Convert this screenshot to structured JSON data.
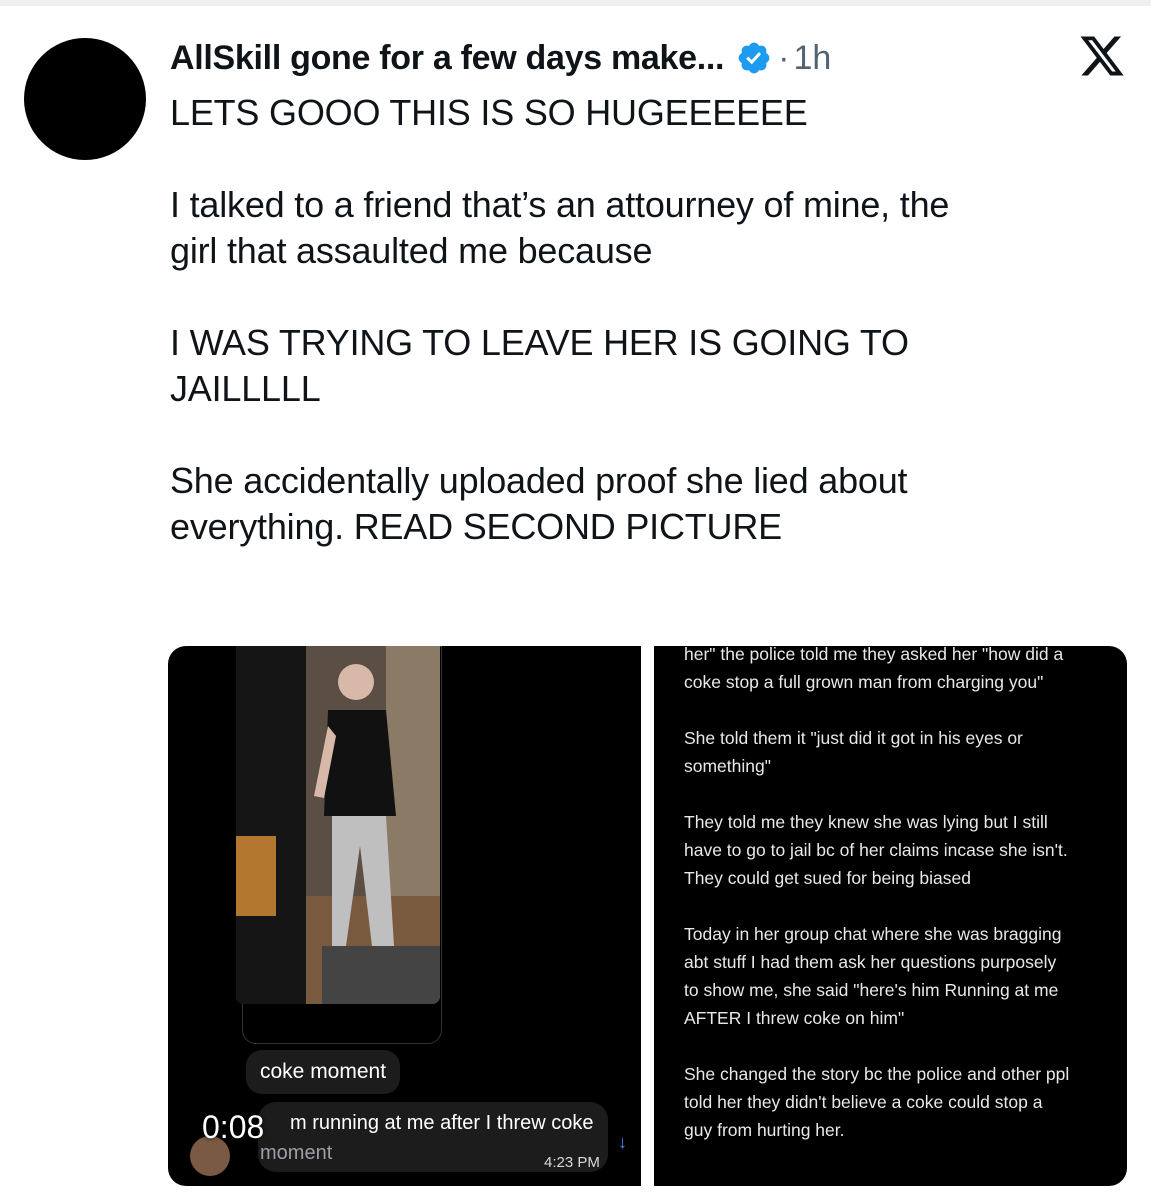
{
  "post": {
    "display_name": "AllSkill gone for a few days make...",
    "separator": "·",
    "time": "1h",
    "paragraphs": [
      "LETS GOOO THIS IS SO HUGEEEEEE",
      "I talked to a friend that’s an attourney of mine, the\ngirl that assaulted me because",
      " I WAS TRYING TO LEAVE HER IS GOING TO\nJAILLLLL",
      "She accidentally uploaded proof she lied about\neverything. READ SECOND PICTURE"
    ]
  },
  "media_left": {
    "duration": "0:08",
    "coke_bubble": "coke moment",
    "running_text": "m running at me after I threw coke",
    "moment_text": "moment",
    "message_time": "4:23 PM"
  },
  "media_right": {
    "notes": [
      "her\" the police told me they asked her \"how did a\ncoke stop a full grown man from charging you\"",
      "She told them it \"just did it got in his eyes or\nsomething\"",
      "They told me they knew she was lying but I still\nhave to go to jail bc of her claims incase she isn't.\nThey could get sued for being biased",
      "Today in her group chat where she was bragging\nabt stuff I had them ask her questions purposely\nto show me, she said \"here's him Running at me\nAFTER I threw coke on him\"",
      "She changed the story bc the police and other ppl\ntold her they didn't believe a coke could stop a\nguy from hurting her."
    ]
  },
  "icons": {
    "verified": "verified-badge-icon",
    "platform": "x-logo-icon"
  },
  "colors": {
    "verified_blue": "#1d9bf0",
    "muted_text": "#536471",
    "text": "#0f1419"
  }
}
